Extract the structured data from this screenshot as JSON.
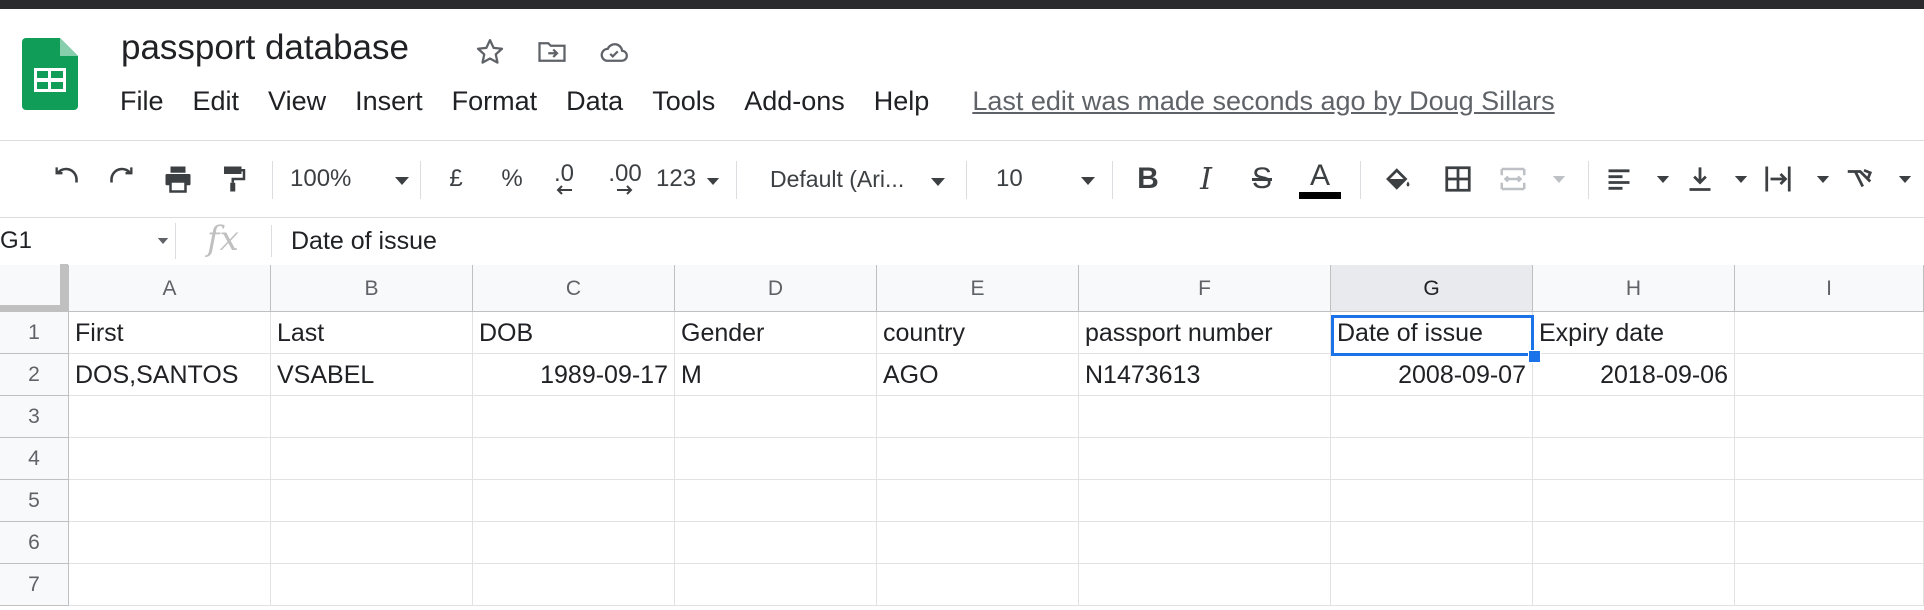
{
  "app": {
    "doc_title": "passport database",
    "brand_color": "#0f9d58"
  },
  "title_icons": [
    "star-icon",
    "move-to-folder-icon",
    "cloud-saved-icon"
  ],
  "menu": {
    "items": [
      "File",
      "Edit",
      "View",
      "Insert",
      "Format",
      "Data",
      "Tools",
      "Add-ons",
      "Help"
    ],
    "last_edit": "Last edit was made seconds ago by Doug Sillars"
  },
  "toolbar": {
    "zoom": "100%",
    "currency": "£",
    "percent": "%",
    "dec_decrease": ".0",
    "dec_increase": ".00",
    "more_formats": "123",
    "font": "Default (Ari...",
    "font_size": "10",
    "bold": "B",
    "italic": "I",
    "strike": "S",
    "text_color": "A"
  },
  "formula_bar": {
    "cell_ref": "G1",
    "fx": "fx",
    "content": "Date of issue"
  },
  "grid": {
    "columns": [
      "A",
      "B",
      "C",
      "D",
      "E",
      "F",
      "G",
      "H",
      "I"
    ],
    "selected_column": "G",
    "rows": [
      {
        "num": "1",
        "cells": [
          "First",
          "Last",
          "DOB",
          "Gender",
          "country",
          "passport number",
          "Date of issue",
          "Expiry date",
          ""
        ]
      },
      {
        "num": "2",
        "cells": [
          "DOS,SANTOS",
          "VSABEL",
          "1989-09-17",
          "M",
          "AGO",
          "N1473613",
          "2008-09-07",
          "2018-09-06",
          ""
        ]
      },
      {
        "num": "3",
        "cells": [
          "",
          "",
          "",
          "",
          "",
          "",
          "",
          "",
          ""
        ]
      },
      {
        "num": "4",
        "cells": [
          "",
          "",
          "",
          "",
          "",
          "",
          "",
          "",
          ""
        ]
      },
      {
        "num": "5",
        "cells": [
          "",
          "",
          "",
          "",
          "",
          "",
          "",
          "",
          ""
        ]
      },
      {
        "num": "6",
        "cells": [
          "",
          "",
          "",
          "",
          "",
          "",
          "",
          "",
          ""
        ]
      },
      {
        "num": "7",
        "cells": [
          "",
          "",
          "",
          "",
          "",
          "",
          "",
          "",
          ""
        ]
      }
    ],
    "selected_cell": "G1",
    "selection_color": "#1a73e8"
  }
}
